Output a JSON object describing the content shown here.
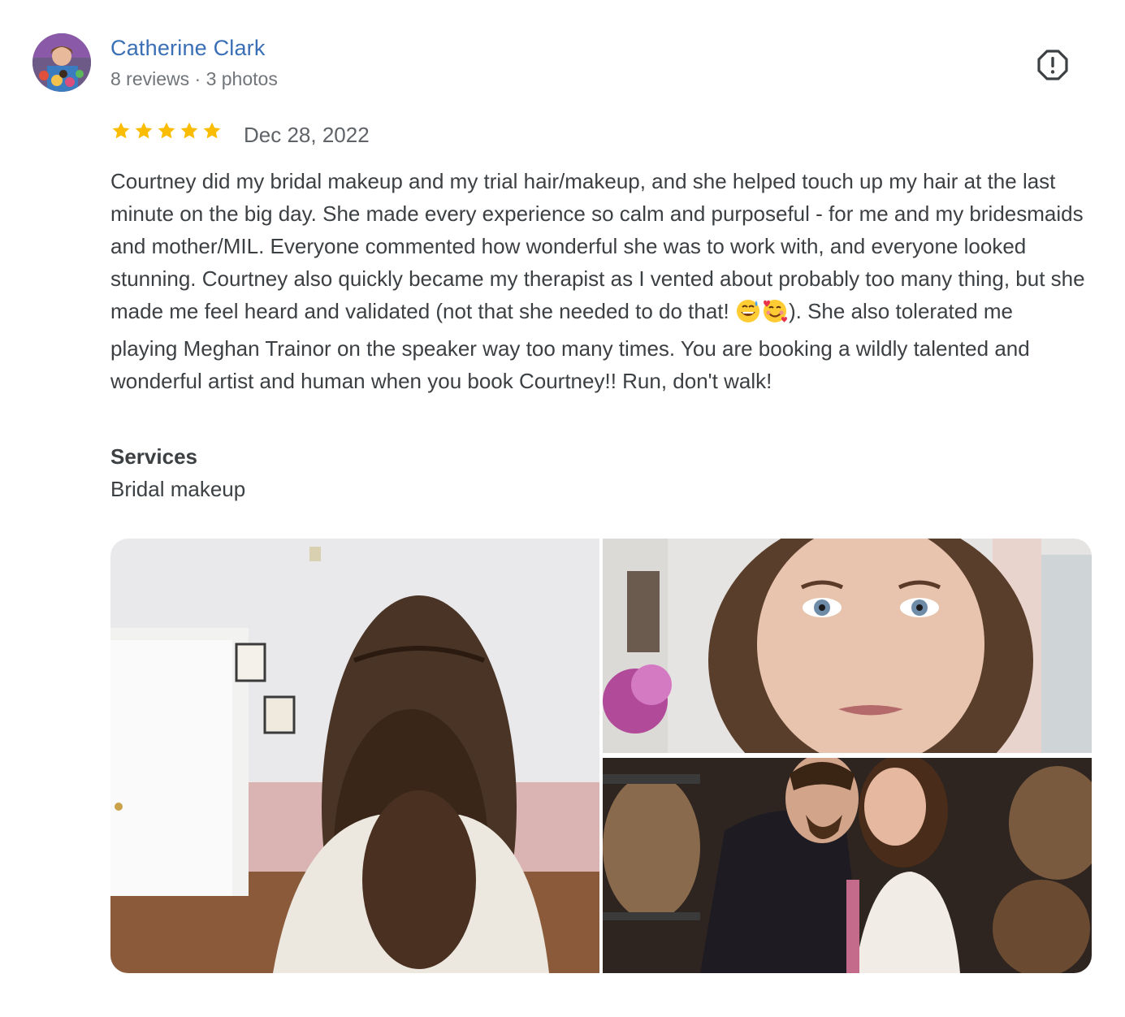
{
  "reviewer": {
    "name": "Catherine Clark",
    "meta": "8 reviews · 3 photos",
    "avatar_icon": "user-avatar-photo"
  },
  "review": {
    "rating": 5,
    "max_rating": 5,
    "date": "Dec 28, 2022",
    "text_part1": "Courtney did my bridal makeup and my trial hair/makeup, and she helped touch up my hair at the last minute on the big day. She made every experience so calm and purposeful - for me and my bridesmaids and mother/MIL. Everyone commented how wonderful she was to work with, and everyone looked stunning. Courtney also quickly became my therapist as I vented about probably too many thing, but she made me feel heard and validated (not that she needed to do that! ",
    "text_part2": "). She also tolerated me playing Meghan Trainor on the speaker way too many times. You are booking a wildly talented and wonderful artist and human when you book Courtney!! Run, don't walk!",
    "emojis": [
      "grinning-face-with-sweat-emoji",
      "smiling-face-with-hearts-emoji"
    ]
  },
  "services": {
    "heading": "Services",
    "value": "Bridal makeup"
  },
  "actions": {
    "report_icon": "report-icon"
  },
  "colors": {
    "name_link": "#3a6fb6",
    "star": "#fbbc04",
    "text": "#3c4043",
    "meta": "#70757a"
  },
  "photos": [
    {
      "icon": "photo-hair-back-view"
    },
    {
      "icon": "photo-makeup-closeup"
    },
    {
      "icon": "photo-wedding-couple"
    }
  ]
}
